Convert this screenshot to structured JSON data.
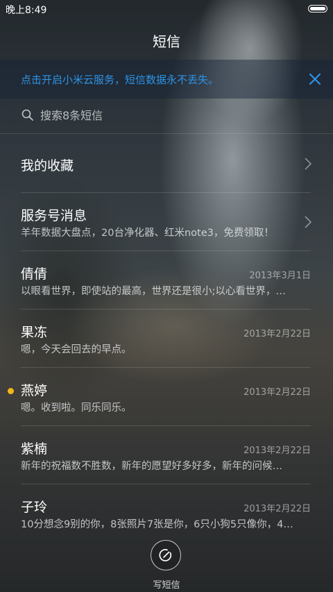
{
  "status_bar": {
    "time": "晚上8:49"
  },
  "header": {
    "title": "短信"
  },
  "banner": {
    "text": "点击开启小米云服务，短信数据永不丢失。",
    "accent": "#2e93e6"
  },
  "search": {
    "placeholder": "搜索8条短信"
  },
  "folders": [
    {
      "label": "我的收藏"
    }
  ],
  "conversations": [
    {
      "name": "服务号消息",
      "preview": "羊年数据大盘点，20台净化器、红米note3，免费领取！",
      "date": "",
      "unread": false
    },
    {
      "name": "倩倩",
      "preview": "以眼看世界，即使站的最高，世界还是很小;以心看世界，…",
      "date": "2013年3月1日",
      "unread": false
    },
    {
      "name": "果冻",
      "preview": "嗯，今天会回去的早点。",
      "date": "2013年2月22日",
      "unread": false
    },
    {
      "name": "燕婷",
      "preview": "嗯。收到啦。同乐同乐。",
      "date": "2013年2月22日",
      "unread": true
    },
    {
      "name": "紫楠",
      "preview": "新年的祝福数不胜数，新年的愿望好多好多，新年的问候…",
      "date": "2013年2月22日",
      "unread": false
    },
    {
      "name": "子玲",
      "preview": "10分想念9别的你，8张照片7张是你，6只小狗5只像你，4…",
      "date": "2013年2月22日",
      "unread": false
    }
  ],
  "compose": {
    "label": "写短信"
  },
  "colors": {
    "unread_dot": "#f3b816"
  }
}
